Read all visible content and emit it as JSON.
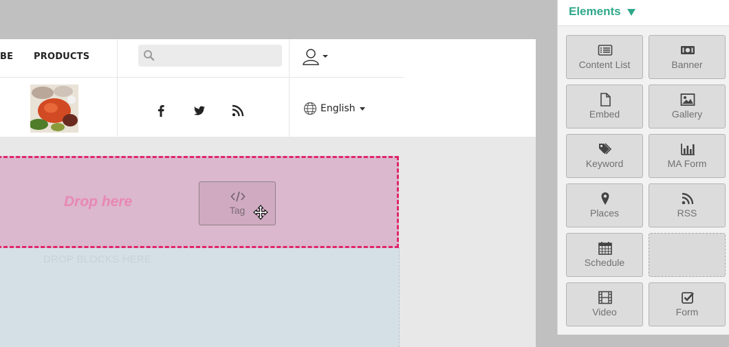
{
  "nav": {
    "subscribe_partial": "BE",
    "products": "PRODUCTS"
  },
  "search": {
    "placeholder": "",
    "value": ""
  },
  "language": {
    "label": "English"
  },
  "drop": {
    "label": "Drop here",
    "hint": "DROP BLOCKS HERE"
  },
  "dragging_block": {
    "label": "Tag",
    "icon": "code-icon"
  },
  "panel": {
    "title": "Elements",
    "tiles": [
      {
        "label": "Content List",
        "icon": "list-icon"
      },
      {
        "label": "Banner",
        "icon": "banner-icon"
      },
      {
        "label": "Embed",
        "icon": "file-icon"
      },
      {
        "label": "Gallery",
        "icon": "image-icon"
      },
      {
        "label": "Keyword",
        "icon": "tags-icon"
      },
      {
        "label": "MA Form",
        "icon": "bar-chart-icon"
      },
      {
        "label": "Places",
        "icon": "map-marker-icon"
      },
      {
        "label": "RSS",
        "icon": "rss-icon"
      },
      {
        "label": "Schedule",
        "icon": "calendar-icon"
      },
      {
        "label": "",
        "icon": ""
      },
      {
        "label": "Video",
        "icon": "film-icon"
      },
      {
        "label": "Form",
        "icon": "checkbox-icon"
      }
    ]
  },
  "colors": {
    "accent": "#2fa889",
    "drop_border": "#e0246b",
    "drop_fill": "#dbb8cd",
    "drop_text": "#e887b6"
  }
}
